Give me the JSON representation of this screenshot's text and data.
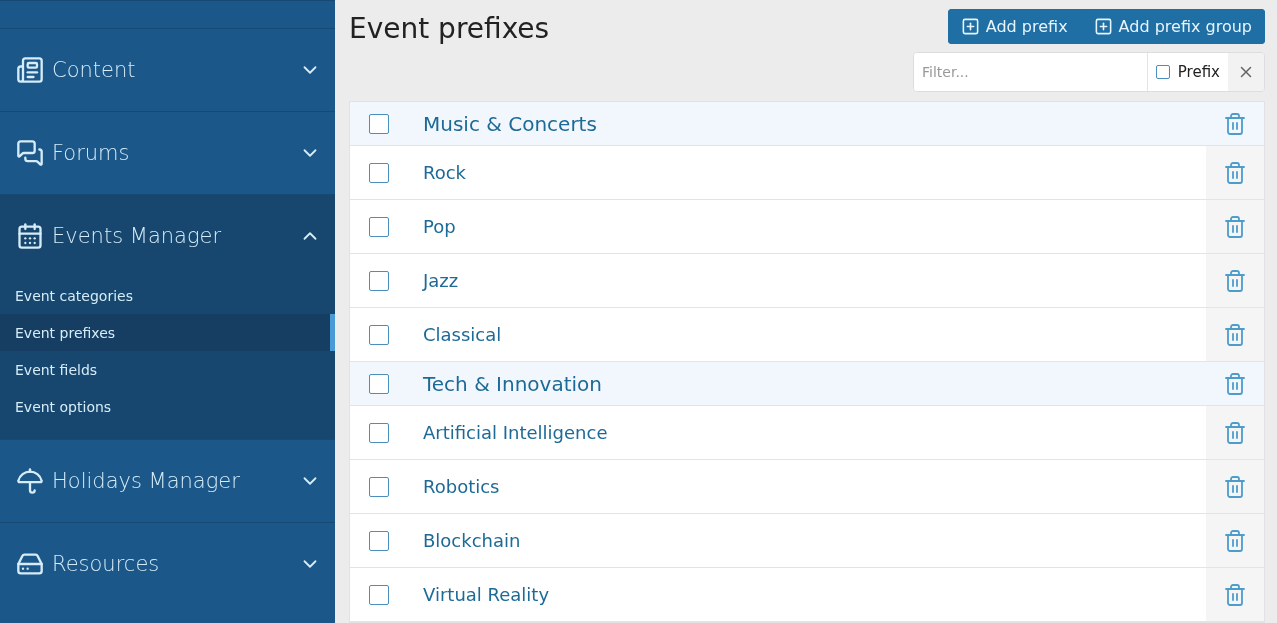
{
  "sidebar": {
    "sections": [
      {
        "label": "Content",
        "expanded": false
      },
      {
        "label": "Forums",
        "expanded": false
      },
      {
        "label": "Events Manager",
        "expanded": true,
        "items": [
          {
            "label": "Event categories",
            "selected": false
          },
          {
            "label": "Event prefixes",
            "selected": true
          },
          {
            "label": "Event fields",
            "selected": false
          },
          {
            "label": "Event options",
            "selected": false
          }
        ]
      },
      {
        "label": "Holidays Manager",
        "expanded": false
      },
      {
        "label": "Resources",
        "expanded": false
      }
    ]
  },
  "page": {
    "title": "Event prefixes",
    "buttons": [
      "Add prefix",
      "Add prefix group"
    ]
  },
  "filter": {
    "placeholder": "Filter...",
    "prefix_label": "Prefix",
    "prefix_checked": false
  },
  "rows": [
    {
      "kind": "group",
      "label": "Music & Concerts",
      "checked": false
    },
    {
      "kind": "item",
      "label": "Rock",
      "checked": false
    },
    {
      "kind": "item",
      "label": "Pop",
      "checked": false
    },
    {
      "kind": "item",
      "label": "Jazz",
      "checked": false
    },
    {
      "kind": "item",
      "label": "Classical",
      "checked": false
    },
    {
      "kind": "group",
      "label": "Tech & Innovation",
      "checked": false
    },
    {
      "kind": "item",
      "label": "Artificial Intelligence",
      "checked": false
    },
    {
      "kind": "item",
      "label": "Robotics",
      "checked": false
    },
    {
      "kind": "item",
      "label": "Blockchain",
      "checked": false
    },
    {
      "kind": "item",
      "label": "Virtual Reality",
      "checked": false
    }
  ]
}
